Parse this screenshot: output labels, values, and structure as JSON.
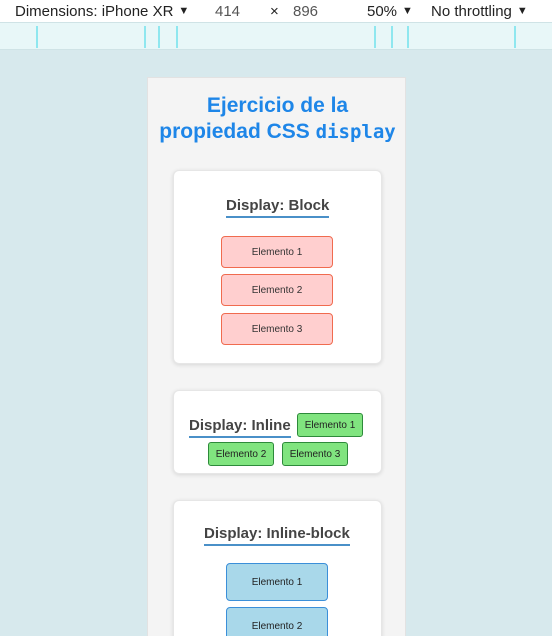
{
  "devtools": {
    "device_label": "Dimensions: iPhone XR",
    "width": "414",
    "times": "×",
    "height": "896",
    "zoom": "50%",
    "throttling": "No throttling"
  },
  "page": {
    "title_line1": "Ejercicio de la",
    "title_line2": "propiedad CSS",
    "title_code": "display"
  },
  "sections": {
    "block": {
      "title": "Display: Block",
      "items": [
        "Elemento 1",
        "Elemento 2",
        "Elemento 3"
      ]
    },
    "inline": {
      "title": "Display: Inline",
      "items": [
        "Elemento 1",
        "Elemento 2",
        "Elemento 3"
      ]
    },
    "inline_block": {
      "title": "Display: Inline-block",
      "items": [
        "Elemento 1",
        "Elemento 2"
      ]
    }
  },
  "colors": {
    "title": "#1e86e8",
    "block_bg": "#ffcfcf",
    "block_border": "#f06b4f",
    "inline_bg": "#80e47f",
    "inline_border": "#2d8a3a",
    "inline_block_bg": "#a9d8ea",
    "inline_block_border": "#3b8fd9"
  }
}
